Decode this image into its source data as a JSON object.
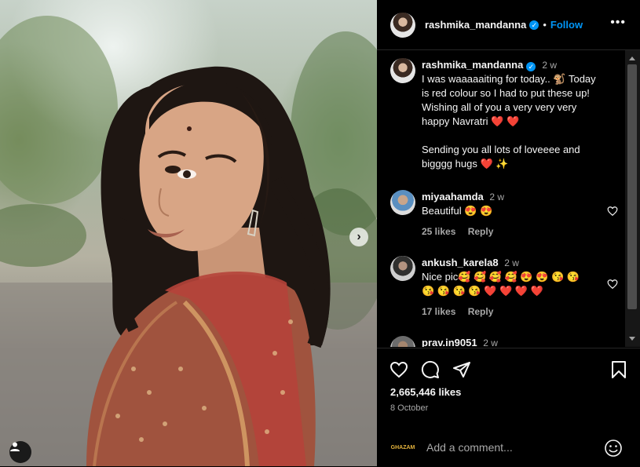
{
  "post": {
    "username": "rashmika_mandanna",
    "follow_label": "Follow",
    "more_label": "•••",
    "caption_time": "2 w",
    "caption": "I was waaaaaiting for today.. 🐒 Today\nis red colour so I had to put these up!\nWishing all of you a very very very\nhappy Navratri ❤️ ❤️\n\nSending you all lots of loveeee and\nbigggg hugs ❤️ ✨",
    "likes": "2,665,446 likes",
    "date": "8 October",
    "carousel_next": "›"
  },
  "comments": [
    {
      "username": "miyaahamda",
      "time": "2 w",
      "text": "Beautiful 😍 😍",
      "likes": "25 likes",
      "reply": "Reply"
    },
    {
      "username": "ankush_karela8",
      "time": "2 w",
      "text": "Nice pic🥰 🥰 🥰 🥰 😍 😍 😘 😘\n😘 😘 😘 😘 ❤️ ❤️ ❤️ ❤️",
      "likes": "17 likes",
      "reply": "Reply"
    },
    {
      "username": "prav.in9051",
      "time": "2 w"
    }
  ],
  "composer": {
    "badge": "GHAZAM",
    "placeholder": "Add a comment..."
  },
  "colors": {
    "accent": "#0095f6",
    "background": "#000000",
    "muted": "#a8a8a8",
    "heart": "#ed4956"
  }
}
